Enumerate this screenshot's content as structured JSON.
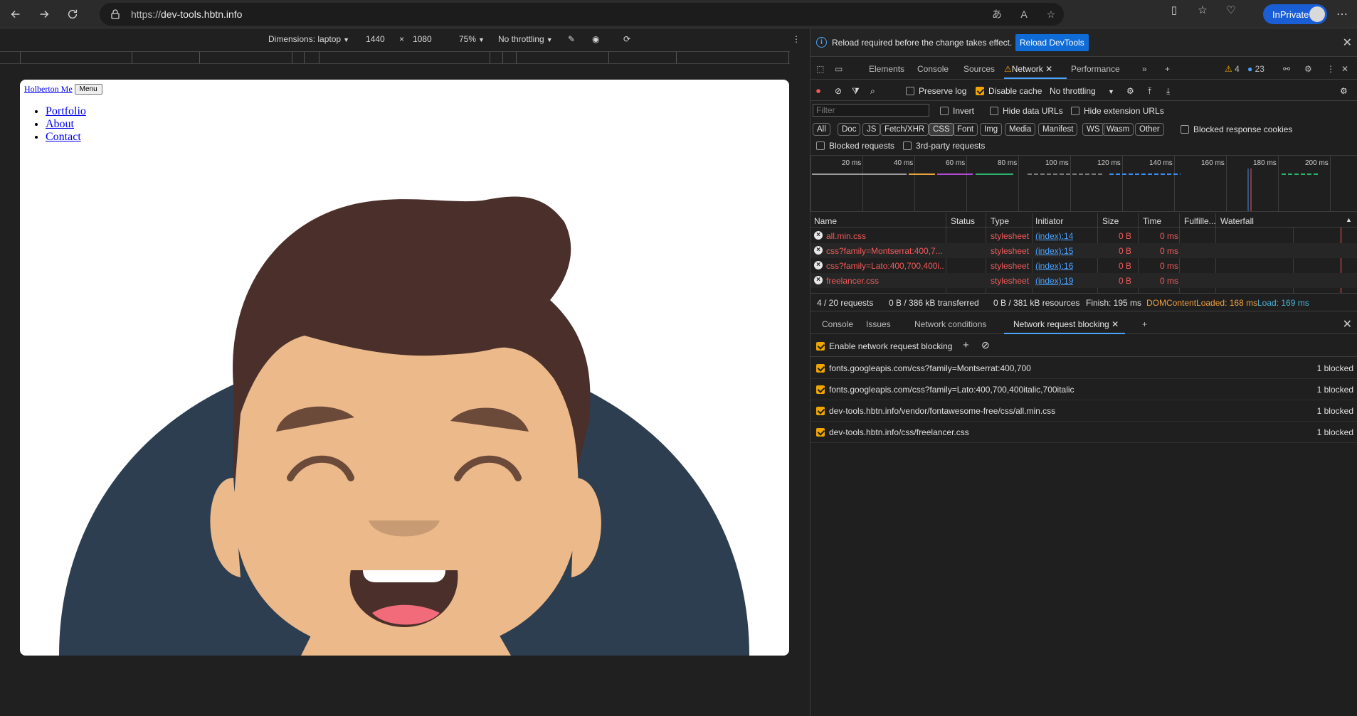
{
  "browser": {
    "url_prefix": "https://",
    "url_host": "dev-tools.hbtn.info",
    "inprivate_label": "InPrivate"
  },
  "device_toolbar": {
    "dimensions_label": "Dimensions: laptop",
    "width": "1440",
    "times": "×",
    "height": "1080",
    "zoom": "75%",
    "throttle": "No throttling"
  },
  "page": {
    "brand_link": "Holberton Me",
    "menu_button": "Menu",
    "nav_links": [
      "Portfolio",
      "About",
      "Contact"
    ]
  },
  "infobar": {
    "message": "Reload required before the change takes effect.",
    "reload_button": "Reload DevTools"
  },
  "devtools_tabs": {
    "elements": "Elements",
    "console": "Console",
    "sources": "Sources",
    "network": "Network",
    "performance": "Performance",
    "warnings": "4",
    "messages": "23"
  },
  "network_toolbar": {
    "preserve_log": "Preserve log",
    "disable_cache": "Disable cache",
    "throttling": "No throttling"
  },
  "filter": {
    "placeholder": "Filter",
    "invert": "Invert",
    "hide_data_urls": "Hide data URLs",
    "hide_extension_urls": "Hide extension URLs"
  },
  "type_filters": [
    "All",
    "Doc",
    "JS",
    "Fetch/XHR",
    "CSS",
    "Font",
    "Img",
    "Media",
    "Manifest",
    "WS",
    "Wasm",
    "Other"
  ],
  "type_extra": {
    "blocked_response_cookies": "Blocked response cookies",
    "blocked_requests": "Blocked requests",
    "third_party": "3rd-party requests"
  },
  "overview_ticks": [
    "20 ms",
    "40 ms",
    "60 ms",
    "80 ms",
    "100 ms",
    "120 ms",
    "140 ms",
    "160 ms",
    "180 ms",
    "200 ms"
  ],
  "table": {
    "headers": {
      "name": "Name",
      "status": "Status",
      "type": "Type",
      "initiator": "Initiator",
      "size": "Size",
      "time": "Time",
      "fulfilled": "Fulfille...",
      "waterfall": "Waterfall"
    },
    "rows": [
      {
        "name": "all.min.css",
        "type": "stylesheet",
        "initiator": "(index):14",
        "size": "0 B",
        "time": "0 ms"
      },
      {
        "name": "css?family=Montserrat:400,7...",
        "type": "stylesheet",
        "initiator": "(index):15",
        "size": "0 B",
        "time": "0 ms"
      },
      {
        "name": "css?family=Lato:400,700,400i...",
        "type": "stylesheet",
        "initiator": "(index):16",
        "size": "0 B",
        "time": "0 ms"
      },
      {
        "name": "freelancer.css",
        "type": "stylesheet",
        "initiator": "(index):19",
        "size": "0 B",
        "time": "0 ms"
      }
    ]
  },
  "summary": {
    "requests": "4 / 20 requests",
    "transferred": "0 B / 386 kB transferred",
    "resources": "0 B / 381 kB resources",
    "finish": "Finish: 195 ms",
    "dom_content_loaded": "DOMContentLoaded: 168 ms",
    "load": "Load: 169 ms"
  },
  "drawer": {
    "tabs": [
      "Console",
      "Issues",
      "Network conditions",
      "Network request blocking"
    ],
    "enable_label": "Enable network request blocking",
    "patterns": [
      {
        "pattern": "fonts.googleapis.com/css?family=Montserrat:400,700",
        "count": "1 blocked"
      },
      {
        "pattern": "fonts.googleapis.com/css?family=Lato:400,700,400italic,700italic",
        "count": "1 blocked"
      },
      {
        "pattern": "dev-tools.hbtn.info/vendor/fontawesome-free/css/all.min.css",
        "count": "1 blocked"
      },
      {
        "pattern": "dev-tools.hbtn.info/css/freelancer.css",
        "count": "1 blocked"
      }
    ]
  },
  "colors": {
    "accent": "#1a5ed6",
    "error_red": "#f25a5a",
    "link_blue": "#4aa3ff",
    "avatar_bg": "#2c3e50",
    "hair": "#4a2f2a",
    "skin": "#ecb98a"
  }
}
